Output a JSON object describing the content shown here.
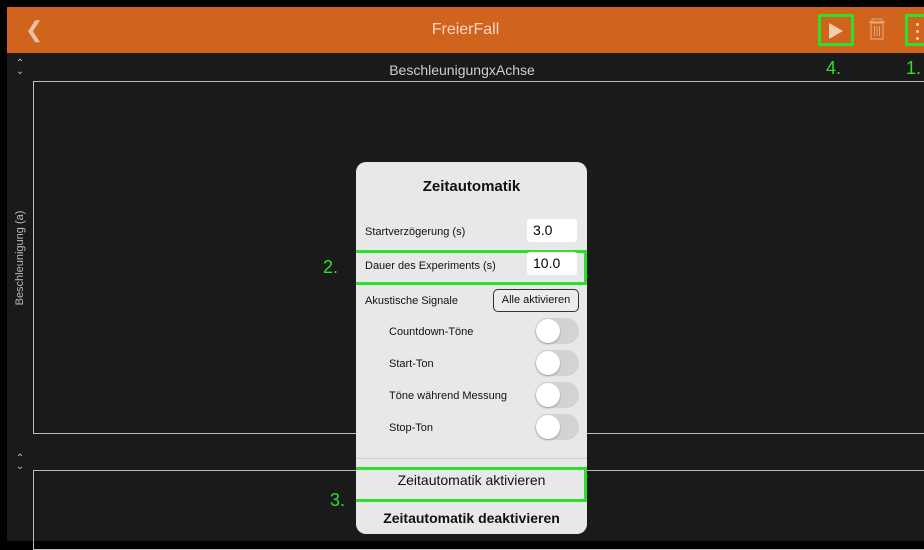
{
  "nav": {
    "back_icon": "chevron-left-icon",
    "title": "FreierFall",
    "play_icon": "play-icon",
    "trash_icon": "trash-icon",
    "menu_icon": "more-vertical-icon"
  },
  "markers": {
    "m1": "1.",
    "m2": "2.",
    "m3": "3.",
    "m4": "4."
  },
  "graph": {
    "title": "BeschleunigungxAchse",
    "ylabel": "Beschleunigung (a)"
  },
  "popover": {
    "title": "Zeitautomatik",
    "start_delay_label": "Startverzögerung (s)",
    "start_delay_value": "3.0",
    "duration_label": "Dauer des Experiments (s)",
    "duration_value": "10.0",
    "acoustic_label": "Akustische Signale",
    "enable_all_label": "Alle aktivieren",
    "toggles": [
      {
        "label": "Countdown-Töne",
        "on": false
      },
      {
        "label": "Start-Ton",
        "on": false
      },
      {
        "label": "Töne während Messung",
        "on": false
      },
      {
        "label": "Stop-Ton",
        "on": false
      }
    ],
    "activate_label": "Zeitautomatik aktivieren",
    "deactivate_label": "Zeitautomatik deaktivieren"
  },
  "colors": {
    "accent": "#d0641d",
    "highlight": "#2ee02e"
  }
}
